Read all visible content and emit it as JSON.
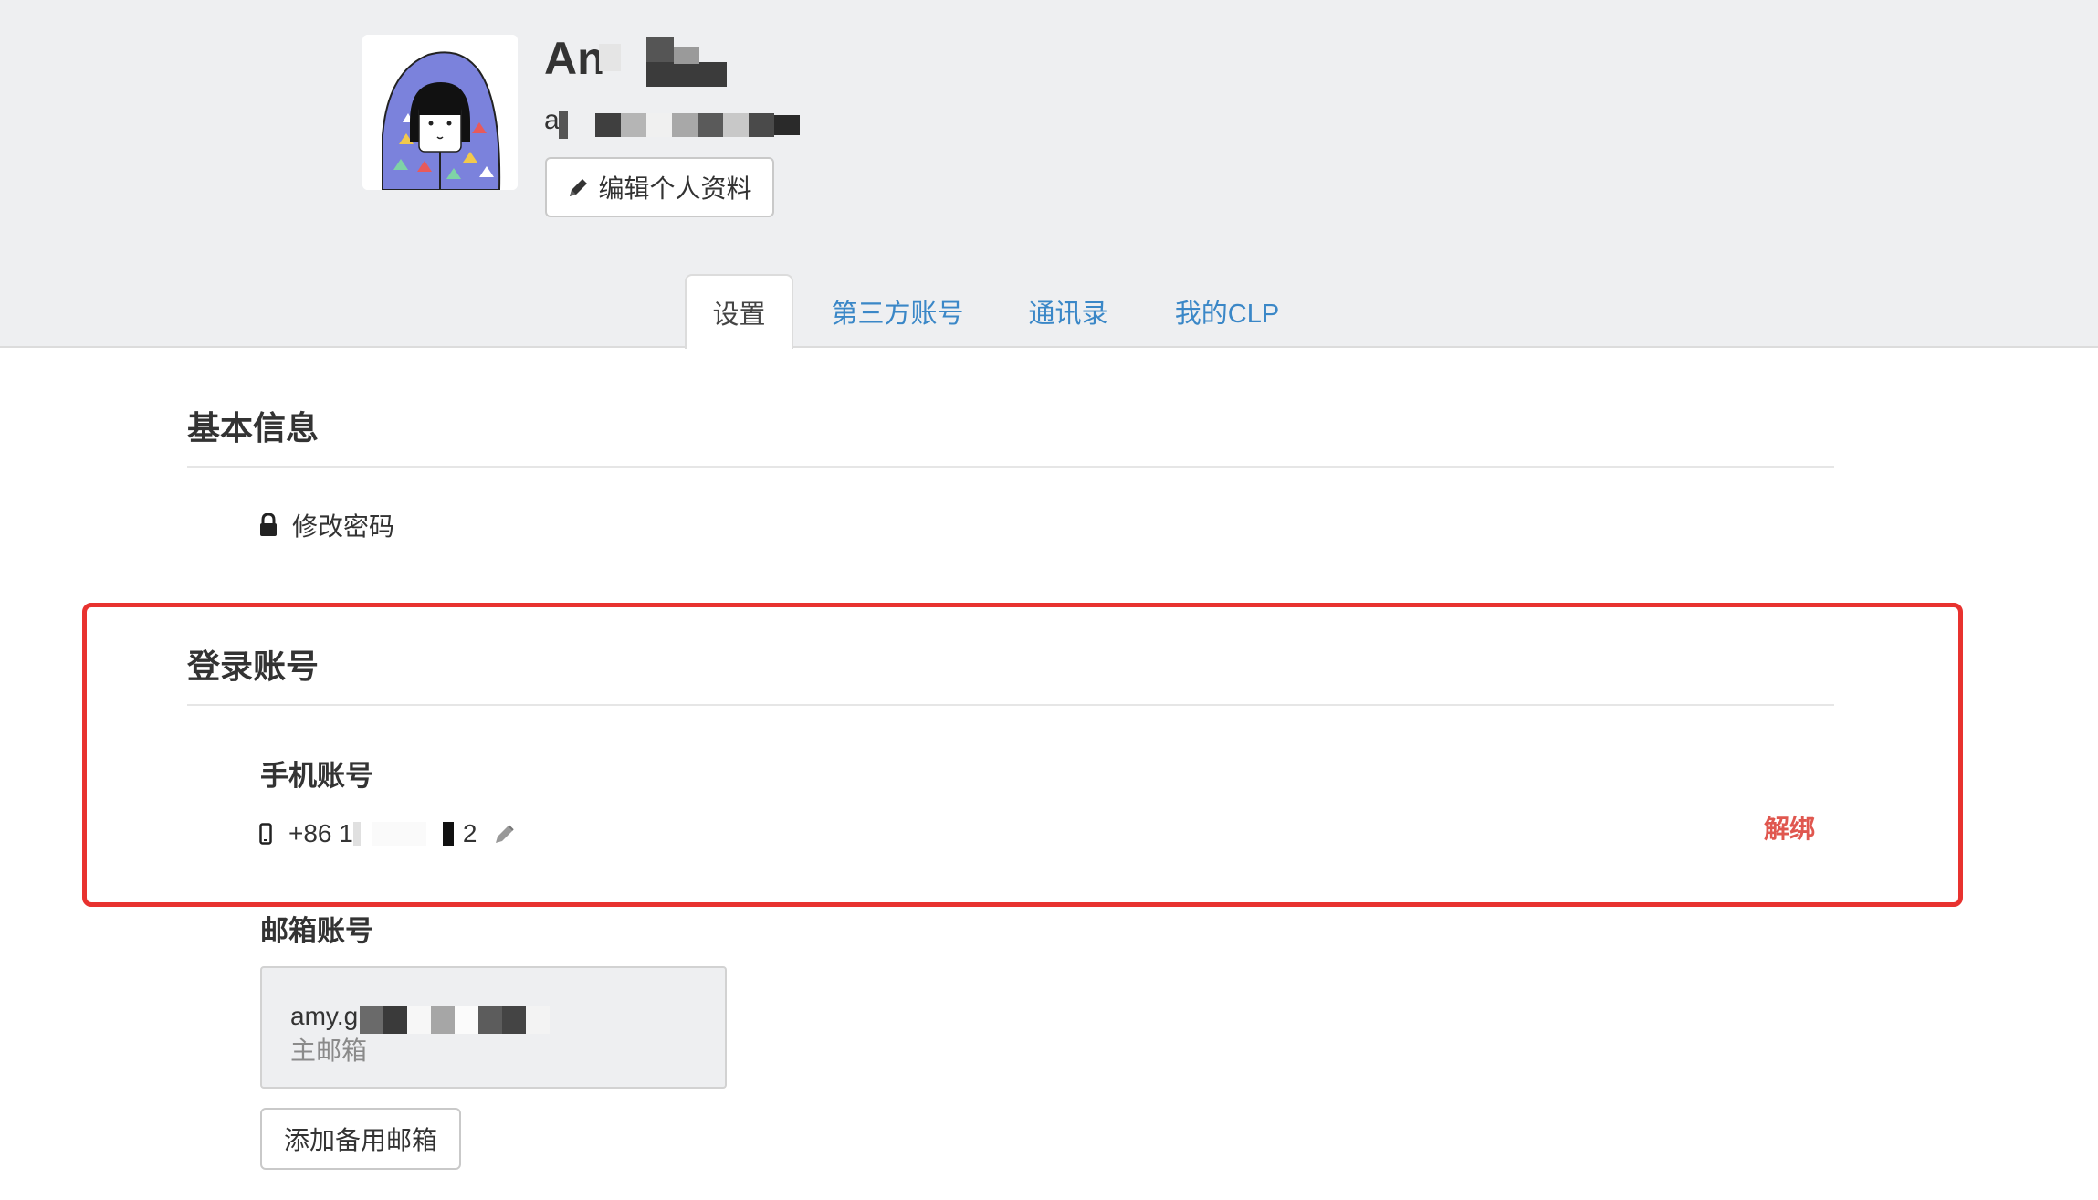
{
  "profile": {
    "name": "An",
    "email": "a",
    "edit_button": "编辑个人资料"
  },
  "tabs": [
    {
      "label": "设置",
      "active": true
    },
    {
      "label": "第三方账号",
      "active": false
    },
    {
      "label": "通讯录",
      "active": false
    },
    {
      "label": "我的CLP",
      "active": false
    }
  ],
  "basic_info": {
    "title": "基本信息",
    "change_password": "修改密码"
  },
  "login_accounts": {
    "title": "登录账号",
    "phone": {
      "label": "手机账号",
      "number_prefix": "+86 1",
      "number_suffix": "2",
      "unbind": "解绑"
    },
    "email": {
      "label": "邮箱账号",
      "address": "amy.g",
      "primary_tag": "主邮箱",
      "add_backup": "添加备用邮箱"
    }
  },
  "colors": {
    "header_bg": "#eeeff1",
    "tab_link": "#3a87c7",
    "unbind": "#e0574f",
    "highlight_border": "#e8322f"
  },
  "icons": [
    "pencil-icon",
    "lock-icon",
    "mobile-phone-icon",
    "edit-pencil-icon"
  ]
}
